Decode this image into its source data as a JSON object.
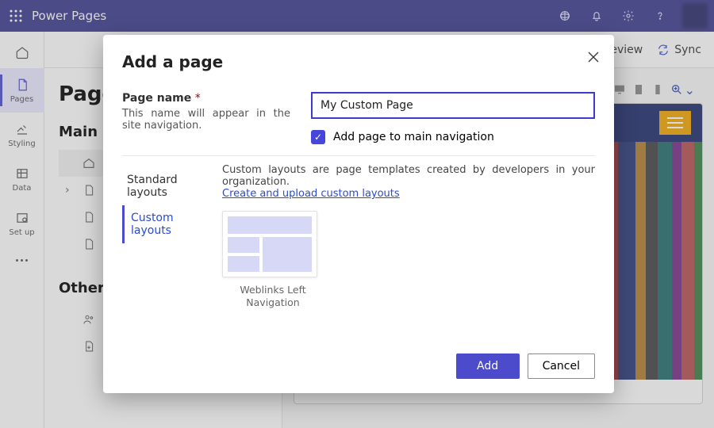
{
  "appbar": {
    "brand": "Power Pages"
  },
  "cmdbar": {
    "preview": "eview",
    "sync": "Sync"
  },
  "leftnav": {
    "items": [
      {
        "label": "Pages"
      },
      {
        "label": "Styling"
      },
      {
        "label": "Data"
      },
      {
        "label": "Set up"
      }
    ]
  },
  "pagespanel": {
    "title": "Page",
    "section_main": "Main",
    "section_other": "Other"
  },
  "toolbar": {
    "zoom_chevron": "⌄"
  },
  "dialog": {
    "title": "Add a page",
    "page_name_label": "Page name",
    "required_mark": "*",
    "page_name_hint": "This name will appear in the site navigation.",
    "page_name_value": "My Custom Page",
    "add_to_nav": "Add page to main navigation",
    "tabs": {
      "standard": "Standard layouts",
      "custom": "Custom layouts"
    },
    "custom_desc": "Custom layouts are page templates created by developers in your organization.",
    "custom_link": "Create and upload custom layouts",
    "tile1_caption": "Weblinks Left Navigation",
    "buttons": {
      "add": "Add",
      "cancel": "Cancel"
    }
  }
}
